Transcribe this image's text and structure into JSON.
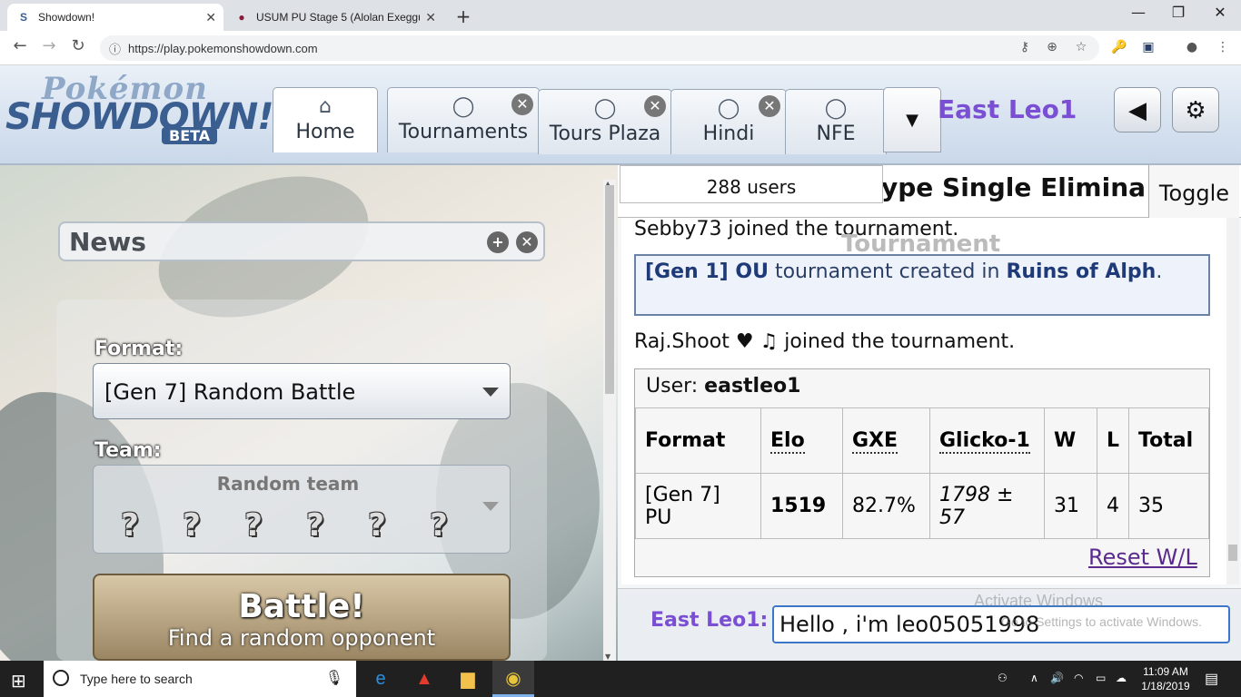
{
  "browser": {
    "tabs": [
      {
        "title": "Showdown!",
        "favicon": "S"
      },
      {
        "title": "USUM PU Stage 5 (Alolan Exeggu",
        "favicon": "●"
      }
    ],
    "url": "https://play.pokemonshowdown.com"
  },
  "ps": {
    "logo": {
      "line1": "Pokémon",
      "line2": "SHOWDOWN!",
      "badge": "BETA"
    },
    "tabs": [
      {
        "label": "Home",
        "icon": "home-icon",
        "glyph": "⌂"
      },
      {
        "label": "Tournaments",
        "icon": "chat-bubble-icon",
        "glyph": "◯"
      },
      {
        "label": "Tours Plaza",
        "icon": "chat-bubble-icon",
        "glyph": "◯"
      },
      {
        "label": "Hindi",
        "icon": "chat-bubble-icon",
        "glyph": "◯"
      },
      {
        "label": "NFE",
        "icon": "chat-bubble-icon",
        "glyph": "◯"
      }
    ],
    "username": "East Leo1"
  },
  "left": {
    "news_title": "News",
    "format_label": "Format:",
    "format_value": "[Gen 7] Random Battle",
    "team_label": "Team:",
    "team_value": "Random team",
    "battle_title": "Battle!",
    "battle_sub": "Find a random opponent"
  },
  "room": {
    "users": "288 users",
    "title": "ype Single Elimina",
    "toggle": "Toggle",
    "tour_label": "Tournament",
    "messages": {
      "m1": "Sebby73 joined the tournament.",
      "notice_gen": "[Gen 1] OU",
      "notice_mid": " tournament created in ",
      "notice_room": "Ruins of Alph",
      "notice_end": ".",
      "m2": "Raj.Shoot ♥ ♫ joined the tournament."
    },
    "ratings": {
      "user_label": "User: ",
      "user": "eastleo1",
      "headers": [
        "Format",
        "Elo",
        "GXE",
        "Glicko-1",
        "W",
        "L",
        "Total"
      ],
      "row": {
        "format": "[Gen 7] PU",
        "elo": "1519",
        "gxe": "82.7%",
        "glicko": "1798 ± 57",
        "w": "31",
        "l": "4",
        "total": "35"
      },
      "reset": "Reset W/L"
    },
    "chat_name": "East Leo1:",
    "chat_input": "Hello , i'm leo05051998"
  },
  "watermark": {
    "line1": "Activate Windows",
    "line2": "Go to Settings to activate Windows."
  },
  "taskbar": {
    "search_placeholder": "Type here to search",
    "time": "11:09 AM",
    "date": "1/18/2019"
  }
}
